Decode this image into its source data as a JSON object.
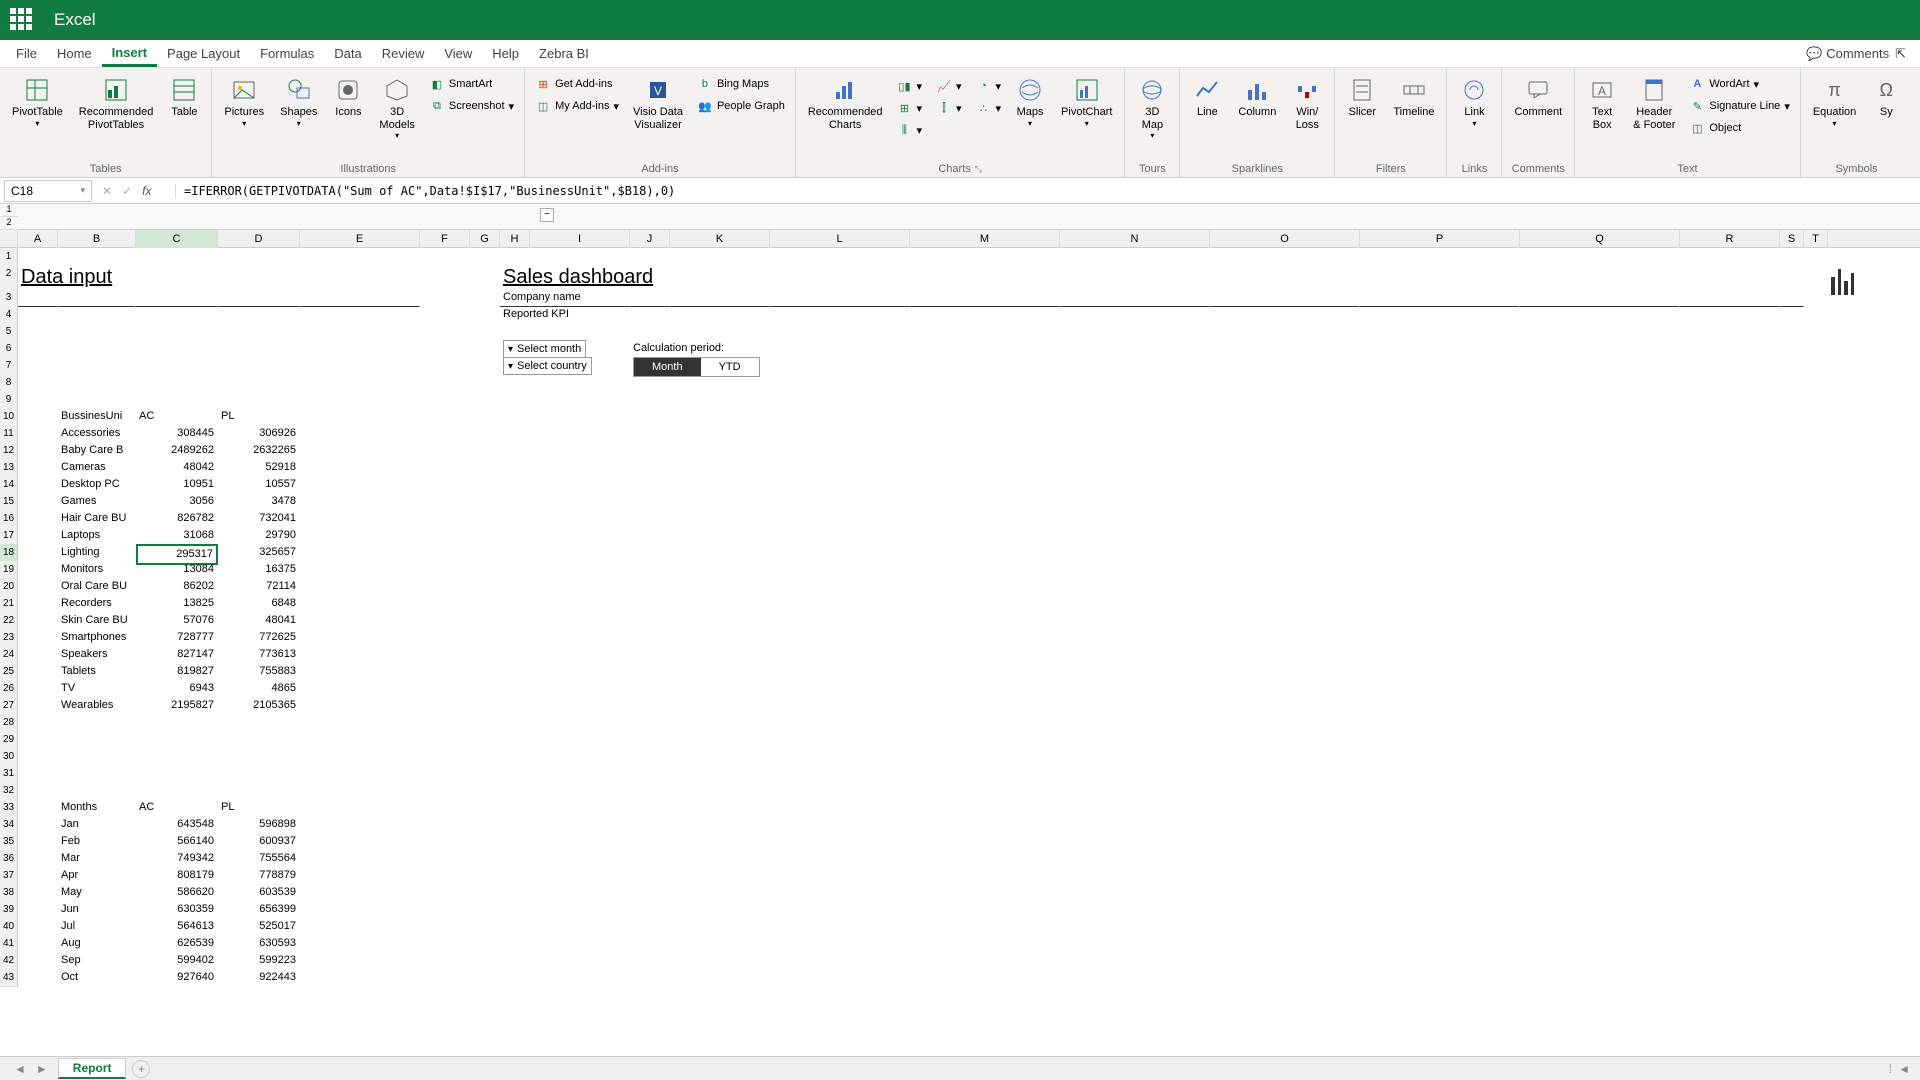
{
  "app": {
    "name": "Excel"
  },
  "menu": {
    "items": [
      "File",
      "Home",
      "Insert",
      "Page Layout",
      "Formulas",
      "Data",
      "Review",
      "View",
      "Help",
      "Zebra BI"
    ],
    "active_index": 2,
    "comments": "Comments"
  },
  "ribbon": {
    "tables": {
      "label": "Tables",
      "pivot": "PivotTable",
      "rec_pivot": "Recommended\nPivotTables",
      "table": "Table"
    },
    "illustrations": {
      "label": "Illustrations",
      "pictures": "Pictures",
      "shapes": "Shapes",
      "icons": "Icons",
      "models": "3D\nModels",
      "smartart": "SmartArt",
      "screenshot": "Screenshot"
    },
    "addins": {
      "label": "Add-ins",
      "get": "Get Add-ins",
      "my": "My Add-ins",
      "visio": "Visio Data\nVisualizer",
      "bing": "Bing Maps",
      "people": "People Graph"
    },
    "charts": {
      "label": "Charts",
      "rec": "Recommended\nCharts",
      "maps": "Maps",
      "pivotchart": "PivotChart"
    },
    "tours": {
      "label": "Tours",
      "map": "3D\nMap"
    },
    "sparklines": {
      "label": "Sparklines",
      "line": "Line",
      "column": "Column",
      "winloss": "Win/\nLoss"
    },
    "filters": {
      "label": "Filters",
      "slicer": "Slicer",
      "timeline": "Timeline"
    },
    "links": {
      "label": "Links",
      "link": "Link"
    },
    "comments": {
      "label": "Comments",
      "comment": "Comment"
    },
    "text": {
      "label": "Text",
      "textbox": "Text\nBox",
      "header": "Header\n& Footer",
      "wordart": "WordArt",
      "sig": "Signature Line",
      "obj": "Object"
    },
    "symbols": {
      "label": "Symbols",
      "eq": "Equation",
      "sy": "Sy"
    }
  },
  "formula": {
    "cell_ref": "C18",
    "formula": "=IFERROR(GETPIVOTDATA(\"Sum of AC\",Data!$I$17,\"BusinessUnit\",$B18),0)"
  },
  "columns": [
    "A",
    "B",
    "C",
    "D",
    "E",
    "F",
    "G",
    "H",
    "I",
    "J",
    "K",
    "L",
    "M",
    "N",
    "O",
    "P",
    "Q",
    "R",
    "S",
    "T"
  ],
  "sheet": {
    "data_input_title": "Data input",
    "dashboard_title": "Sales dashboard",
    "company": "Company name",
    "kpi": "Reported KPI",
    "select_month": "Select month",
    "select_country": "Select country",
    "calc_period": "Calculation period:",
    "segment_month": "Month",
    "segment_ytd": "YTD",
    "bu_header": {
      "b": "BussinesUni",
      "c": "AC",
      "d": "PL"
    },
    "bu_rows": [
      {
        "b": "Accessories",
        "c": "308445",
        "d": "306926"
      },
      {
        "b": "Baby Care B",
        "c": "2489262",
        "d": "2632265"
      },
      {
        "b": "Cameras",
        "c": "48042",
        "d": "52918"
      },
      {
        "b": "Desktop PC",
        "c": "10951",
        "d": "10557"
      },
      {
        "b": "Games",
        "c": "3056",
        "d": "3478"
      },
      {
        "b": "Hair Care BU",
        "c": "826782",
        "d": "732041"
      },
      {
        "b": "Laptops",
        "c": "31068",
        "d": "29790"
      },
      {
        "b": "Lighting",
        "c": "295317",
        "d": "325657"
      },
      {
        "b": "Monitors",
        "c": "13084",
        "d": "16375"
      },
      {
        "b": "Oral Care BU",
        "c": "86202",
        "d": "72114"
      },
      {
        "b": "Recorders",
        "c": "13825",
        "d": "6848"
      },
      {
        "b": "Skin Care BU",
        "c": "57076",
        "d": "48041"
      },
      {
        "b": "Smartphones",
        "c": "728777",
        "d": "772625"
      },
      {
        "b": "Speakers",
        "c": "827147",
        "d": "773613"
      },
      {
        "b": "Tablets",
        "c": "819827",
        "d": "755883"
      },
      {
        "b": "TV",
        "c": "6943",
        "d": "4865"
      },
      {
        "b": "Wearables",
        "c": "2195827",
        "d": "2105365"
      }
    ],
    "month_header": {
      "b": "Months",
      "c": "AC",
      "d": "PL"
    },
    "month_rows": [
      {
        "b": "Jan",
        "c": "643548",
        "d": "596898"
      },
      {
        "b": "Feb",
        "c": "566140",
        "d": "600937"
      },
      {
        "b": "Mar",
        "c": "749342",
        "d": "755564"
      },
      {
        "b": "Apr",
        "c": "808179",
        "d": "778879"
      },
      {
        "b": "May",
        "c": "586620",
        "d": "603539"
      },
      {
        "b": "Jun",
        "c": "630359",
        "d": "656399"
      },
      {
        "b": "Jul",
        "c": "564613",
        "d": "525017"
      },
      {
        "b": "Aug",
        "c": "626539",
        "d": "630593"
      },
      {
        "b": "Sep",
        "c": "599402",
        "d": "599223"
      },
      {
        "b": "Oct",
        "c": "927640",
        "d": "922443"
      }
    ],
    "selected_row": 18
  },
  "tabs": {
    "active": "Report"
  }
}
